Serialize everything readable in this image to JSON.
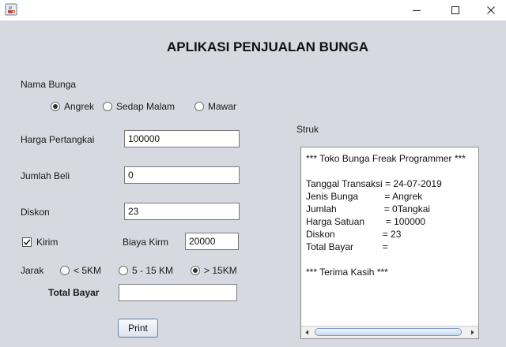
{
  "window": {
    "app_icon": "java-cup-icon",
    "controls": [
      "minimize-icon",
      "maximize-icon",
      "close-icon"
    ]
  },
  "form": {
    "title": "APLIKASI PENJUALAN BUNGA",
    "nama_bunga_label": "Nama Bunga",
    "flower_options": [
      {
        "label": "Angrek",
        "selected": true
      },
      {
        "label": "Sedap Malam",
        "selected": false
      },
      {
        "label": "Mawar",
        "selected": false
      }
    ],
    "harga_label": "Harga Pertangkai",
    "harga_value": "100000",
    "jumlah_label": "Jumlah Beli",
    "jumlah_value": "0",
    "diskon_label": "Diskon",
    "diskon_value": "23",
    "kirim_label": "Kirim",
    "kirim_checked": true,
    "biaya_label": "Biaya Kirm",
    "biaya_value": "20000",
    "jarak_label": "Jarak",
    "distance_options": [
      {
        "label": "< 5KM",
        "selected": false
      },
      {
        "label": "5 - 15 KM",
        "selected": false
      },
      {
        "label": "> 15KM",
        "selected": true
      }
    ],
    "total_label": "Total Bayar",
    "total_value": "",
    "print_label": "Print"
  },
  "receipt": {
    "label": "Struk",
    "lines": [
      "*** Toko Bunga Freak Programmer ***",
      "",
      "Tanggal Transaksi = 24-07-2019",
      "Jenis Bunga          = Angrek",
      "Jumlah                  = 0Tangkai",
      "Harga Satuan        = 100000",
      "Diskon                  = 23",
      "Total Bayar           =",
      "",
      "*** Terima Kasih ***"
    ]
  }
}
